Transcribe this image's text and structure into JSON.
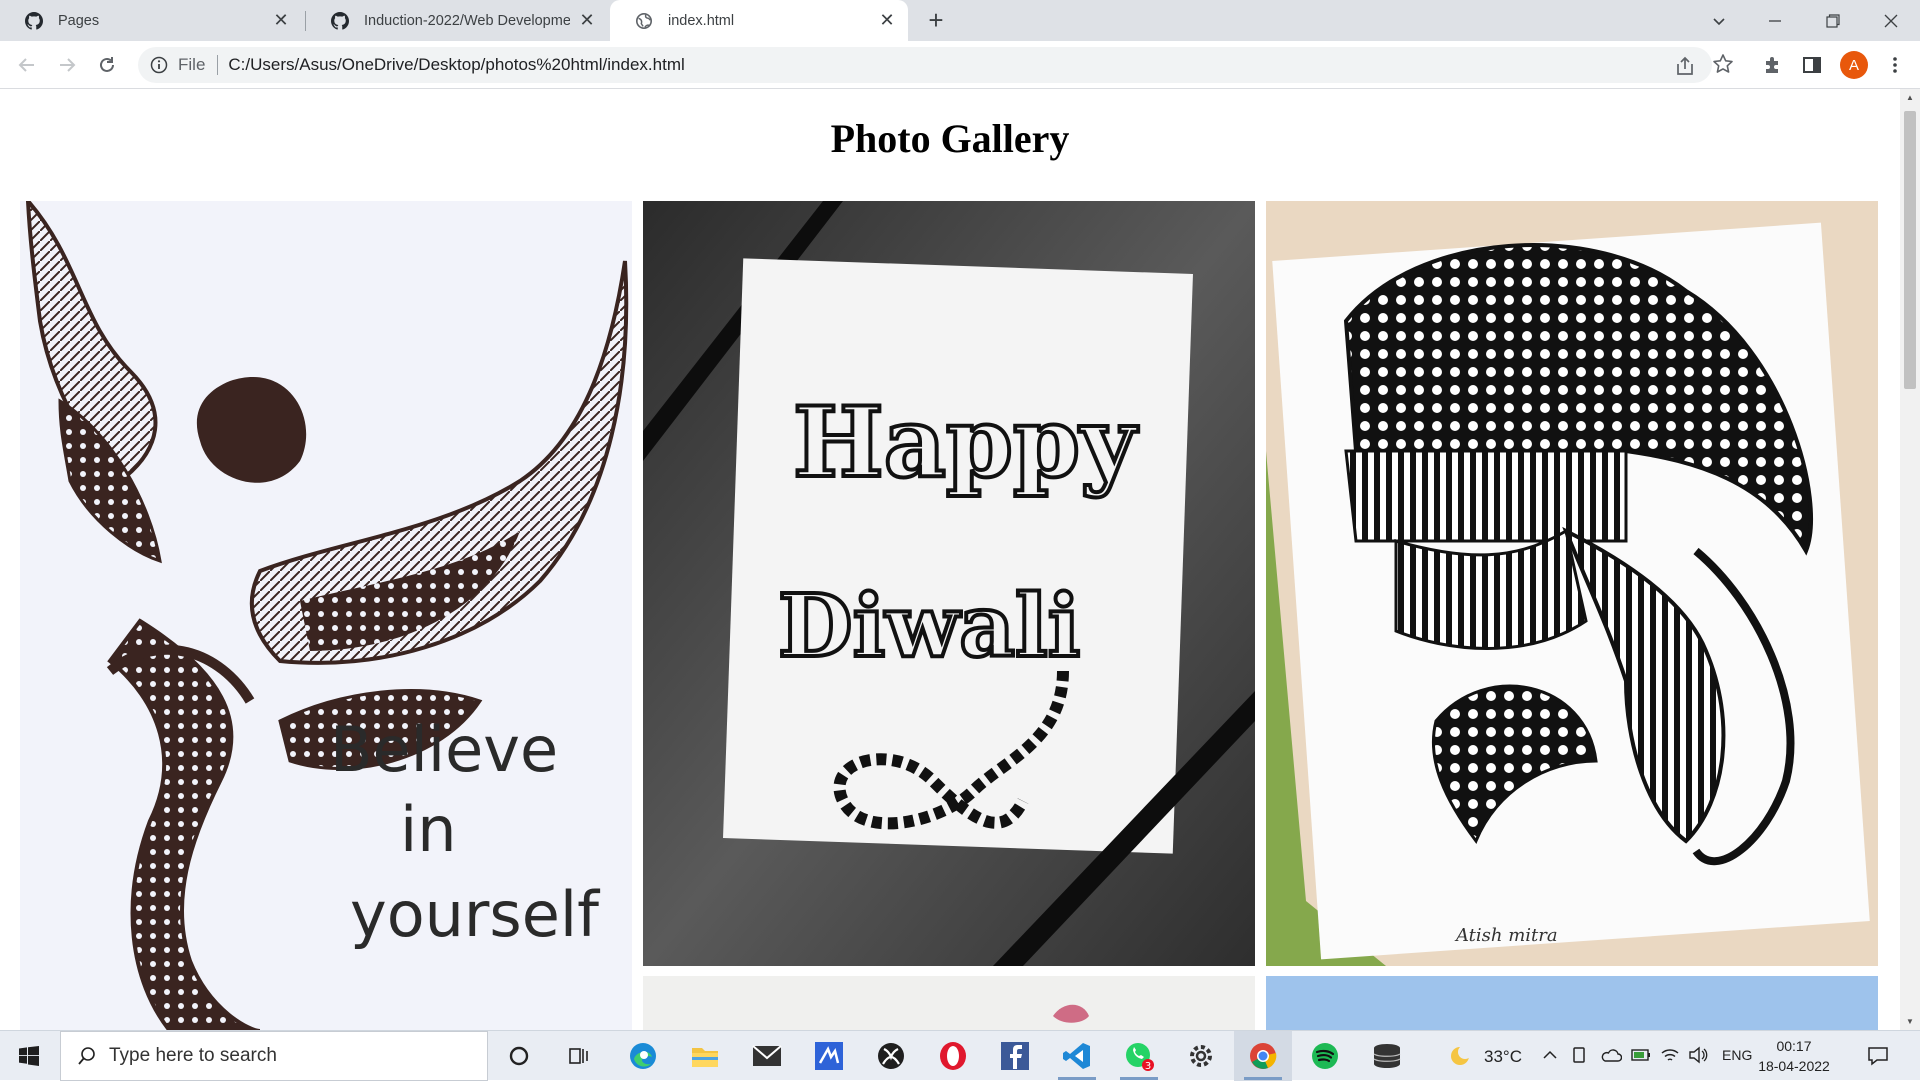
{
  "browser": {
    "tabs": [
      {
        "title": "Pages",
        "icon": "github-icon",
        "active": false
      },
      {
        "title": "Induction-2022/Web Developme",
        "icon": "github-icon",
        "active": false
      },
      {
        "title": "index.html",
        "icon": "globe-icon",
        "active": true
      }
    ],
    "address": {
      "scheme_label": "File",
      "url": "C:/Users/Asus/OneDrive/Desktop/photos%20html/index.html"
    },
    "profile_initial": "A",
    "colors": {
      "profile": "#e8580c",
      "tab_strip": "#dee1e6"
    }
  },
  "page": {
    "title": "Photo Gallery",
    "photos": [
      {
        "name": "believe-in-yourself",
        "caption": "Believe in yourself"
      },
      {
        "name": "happy-diwali",
        "caption": "Happy Diwali"
      },
      {
        "name": "mandala-face",
        "signature": "Atish mitra"
      },
      {
        "name": "photo-4"
      },
      {
        "name": "photo-5"
      }
    ]
  },
  "taskbar": {
    "search_placeholder": "Type here to search",
    "apps": [
      "cortana",
      "task-view",
      "edge",
      "file-explorer",
      "mail",
      "visual-studio-online",
      "xbox",
      "opera",
      "facebook",
      "vscode",
      "whatsapp",
      "settings",
      "chrome",
      "spotify",
      "database"
    ],
    "whatsapp_badge": "3",
    "weather": "33°C",
    "language": "ENG",
    "time": "00:17",
    "date": "18-04-2022"
  }
}
